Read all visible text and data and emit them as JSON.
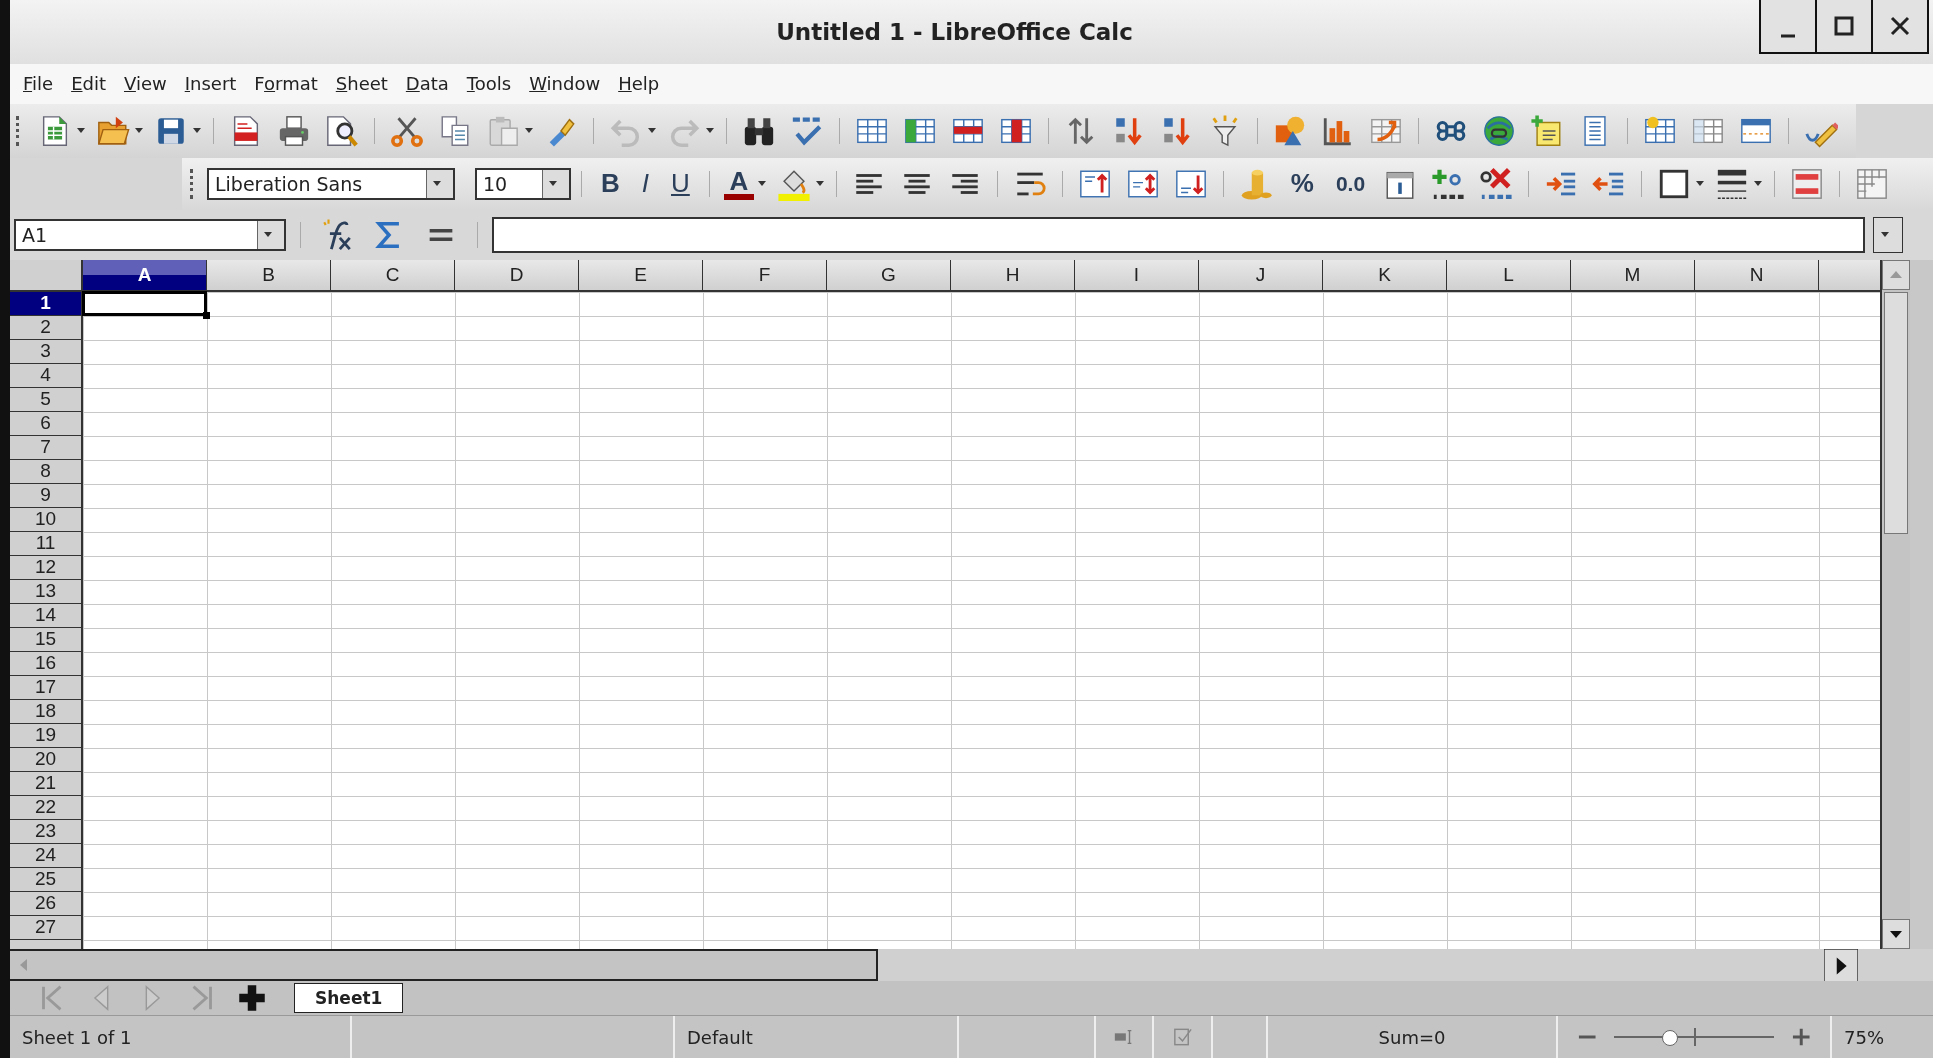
{
  "window": {
    "title": "Untitled 1 - LibreOffice Calc"
  },
  "menu": [
    {
      "mnemonic": "F",
      "rest": "ile"
    },
    {
      "mnemonic": "E",
      "rest": "dit"
    },
    {
      "mnemonic": "V",
      "rest": "iew"
    },
    {
      "mnemonic": "I",
      "rest": "nsert"
    },
    {
      "prefix": "F",
      "mnemonic": "o",
      "rest": "rmat"
    },
    {
      "mnemonic": "S",
      "rest": "heet"
    },
    {
      "mnemonic": "D",
      "rest": "ata"
    },
    {
      "mnemonic": "T",
      "rest": "ools"
    },
    {
      "mnemonic": "W",
      "rest": "indow"
    },
    {
      "mnemonic": "H",
      "rest": "elp"
    }
  ],
  "format_toolbar": {
    "font_name": "Liberation Sans",
    "font_size": "10",
    "bold": "B",
    "italic": "I",
    "underline": "U",
    "font_color": "A",
    "percent": "%",
    "decimal": "0.0"
  },
  "formula_bar": {
    "name_box": "A1"
  },
  "columns": [
    {
      "label": "A",
      "selected": true
    },
    {
      "label": "B",
      "selected": false
    },
    {
      "label": "C",
      "selected": false
    },
    {
      "label": "D",
      "selected": false
    },
    {
      "label": "E",
      "selected": false
    },
    {
      "label": "F",
      "selected": false
    },
    {
      "label": "G",
      "selected": false
    },
    {
      "label": "H",
      "selected": false
    },
    {
      "label": "I",
      "selected": false
    },
    {
      "label": "J",
      "selected": false
    },
    {
      "label": "K",
      "selected": false
    },
    {
      "label": "L",
      "selected": false
    },
    {
      "label": "M",
      "selected": false
    },
    {
      "label": "N",
      "selected": false
    }
  ],
  "rows": [
    {
      "label": "1",
      "selected": true
    },
    {
      "label": "2",
      "selected": false
    },
    {
      "label": "3",
      "selected": false
    },
    {
      "label": "4",
      "selected": false
    },
    {
      "label": "5",
      "selected": false
    },
    {
      "label": "6",
      "selected": false
    },
    {
      "label": "7",
      "selected": false
    },
    {
      "label": "8",
      "selected": false
    },
    {
      "label": "9",
      "selected": false
    },
    {
      "label": "10",
      "selected": false
    },
    {
      "label": "11",
      "selected": false
    },
    {
      "label": "12",
      "selected": false
    },
    {
      "label": "13",
      "selected": false
    },
    {
      "label": "14",
      "selected": false
    },
    {
      "label": "15",
      "selected": false
    },
    {
      "label": "16",
      "selected": false
    },
    {
      "label": "17",
      "selected": false
    },
    {
      "label": "18",
      "selected": false
    },
    {
      "label": "19",
      "selected": false
    },
    {
      "label": "20",
      "selected": false
    },
    {
      "label": "21",
      "selected": false
    },
    {
      "label": "22",
      "selected": false
    },
    {
      "label": "23",
      "selected": false
    },
    {
      "label": "24",
      "selected": false
    },
    {
      "label": "25",
      "selected": false
    },
    {
      "label": "26",
      "selected": false
    },
    {
      "label": "27",
      "selected": false
    }
  ],
  "sheet_tabs": [
    {
      "label": "Sheet1",
      "selected": true
    }
  ],
  "status_bar": {
    "sheet": "Sheet 1 of 1",
    "page_style": "Default",
    "sum": "Sum=0",
    "zoom": {
      "level": 0.34
    },
    "zoom_percent": "75%"
  }
}
